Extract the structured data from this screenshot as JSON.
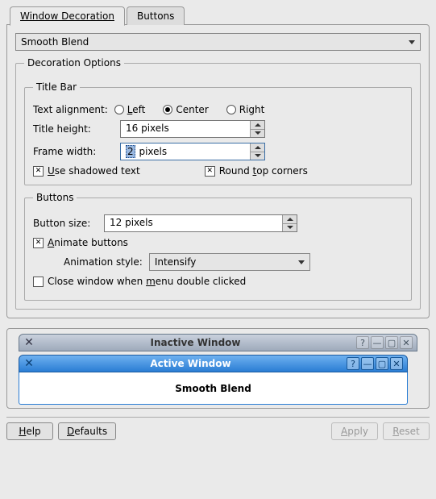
{
  "tabs": {
    "t0": "Window Decoration",
    "t1": "Buttons"
  },
  "combo_theme": "Smooth Blend",
  "decoration_options_legend": "Decoration Options",
  "titlebar": {
    "legend": "Title Bar",
    "text_alignment_label": "Text alignment:",
    "align_left": "Left",
    "align_center": "Center",
    "align_right": "Right",
    "alignment_value": "Center",
    "title_height_label": "Title height:",
    "title_height_value": "16 pixels",
    "frame_width_label": "Frame width:",
    "frame_width_num": "2",
    "frame_width_suffix": " pixels",
    "use_shadowed_text": "Use shadowed text",
    "use_shadowed_text_checked": true,
    "round_top_corners": "Round top corners",
    "round_top_corners_checked": true
  },
  "buttons": {
    "legend": "Buttons",
    "button_size_label": "Button size:",
    "button_size_value": "12 pixels",
    "animate_buttons": "Animate buttons",
    "animate_buttons_checked": true,
    "animation_style_label": "Animation style:",
    "animation_style_value": "Intensify",
    "close_on_menu_dblclick": "Close window when menu double clicked",
    "close_on_menu_dblclick_checked": false
  },
  "preview": {
    "inactive_title": "Inactive Window",
    "active_title": "Active Window",
    "body_text": "Smooth Blend"
  },
  "footer": {
    "help": "Help",
    "defaults": "Defaults",
    "apply": "Apply",
    "reset": "Reset"
  },
  "icons": {
    "sysmenu": "✕",
    "help": "?",
    "minimize": "—",
    "maximize": "▢",
    "close": "✕"
  }
}
